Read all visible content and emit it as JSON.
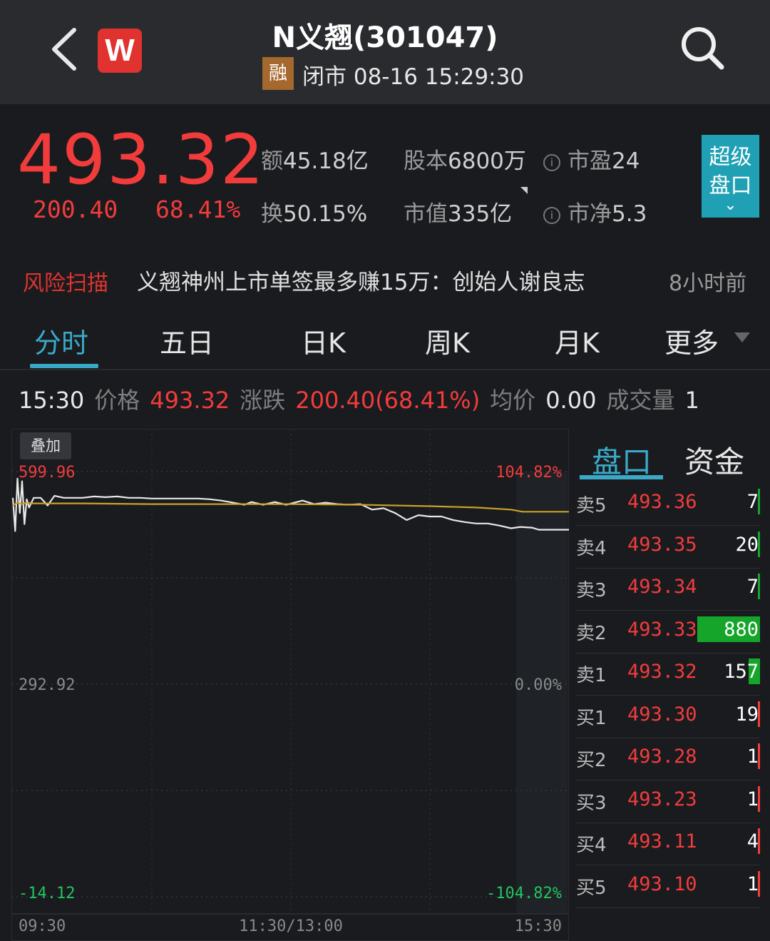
{
  "header": {
    "title": "N义翘(301047)",
    "logo_letter": "W",
    "badge": "融",
    "status": "闭市 08-16 15:29:30"
  },
  "quote": {
    "price": "493.32",
    "change": "200.40",
    "change_pct": "68.41%",
    "turnover_amount": {
      "label": "额",
      "value": "45.18亿"
    },
    "share_capital": {
      "label": "股本",
      "value": "6800万"
    },
    "pe": {
      "label": "市盈",
      "value": "24"
    },
    "turnover_rate": {
      "label": "换",
      "value": "50.15%"
    },
    "market_cap": {
      "label": "市值",
      "value": "335亿"
    },
    "pb": {
      "label": "市净",
      "value": "5.3"
    },
    "super_button": [
      "超级",
      "盘口"
    ]
  },
  "news": {
    "label": "风险扫描",
    "text": "义翘神州上市单签最多赚15万：创始人谢良志",
    "time": "8小时前"
  },
  "tabs": [
    "分时",
    "五日",
    "日K",
    "周K",
    "月K",
    "更多"
  ],
  "info_line": {
    "time": "15:30",
    "price_label": "价格",
    "price": "493.32",
    "change_label": "涨跌",
    "change": "200.40(68.41%)",
    "avg_label": "均价",
    "avg": "0.00",
    "vol_label": "成交量",
    "vol": "1"
  },
  "chart_data": {
    "type": "line",
    "overlay_button": "叠加",
    "y_left_labels": [
      "599.96",
      "292.92",
      "-14.12"
    ],
    "y_right_labels": [
      "104.82%",
      "0.00%",
      "-104.82%"
    ],
    "x_labels": [
      "09:30",
      "11:30/13:00",
      "15:30"
    ],
    "ylim": [
      -14.12,
      599.96
    ],
    "base": 292.92,
    "total_minutes": 240,
    "series": [
      {
        "points": [
          [
            0,
            562
          ],
          [
            1,
            514
          ],
          [
            2,
            590
          ],
          [
            3,
            540
          ],
          [
            4,
            586
          ],
          [
            5,
            524
          ],
          [
            6,
            560
          ],
          [
            7,
            548
          ],
          [
            9,
            562
          ],
          [
            12,
            562
          ],
          [
            15,
            551
          ],
          [
            18,
            565
          ],
          [
            22,
            562
          ],
          [
            26,
            562
          ],
          [
            30,
            562
          ],
          [
            35,
            564
          ],
          [
            40,
            563
          ],
          [
            45,
            564
          ],
          [
            50,
            562
          ],
          [
            55,
            562
          ],
          [
            60,
            561
          ],
          [
            65,
            561
          ],
          [
            70,
            561
          ],
          [
            75,
            561
          ],
          [
            80,
            561
          ],
          [
            85,
            560
          ],
          [
            90,
            558
          ],
          [
            95,
            555
          ],
          [
            100,
            552
          ],
          [
            103,
            556
          ],
          [
            108,
            552
          ],
          [
            113,
            556
          ],
          [
            118,
            552
          ],
          [
            125,
            558
          ],
          [
            130,
            553
          ],
          [
            135,
            555
          ],
          [
            140,
            553
          ],
          [
            145,
            552
          ],
          [
            150,
            553
          ],
          [
            155,
            545
          ],
          [
            160,
            547
          ],
          [
            165,
            540
          ],
          [
            170,
            530
          ],
          [
            175,
            537
          ],
          [
            180,
            535
          ],
          [
            185,
            535
          ],
          [
            190,
            530
          ],
          [
            195,
            527
          ],
          [
            200,
            525
          ],
          [
            205,
            525
          ],
          [
            210,
            522
          ],
          [
            215,
            518
          ],
          [
            219,
            520
          ],
          [
            224,
            519
          ],
          [
            227,
            516
          ],
          [
            232,
            516
          ],
          [
            236,
            516
          ],
          [
            240,
            516
          ]
        ]
      },
      {
        "points": [
          [
            0,
            551
          ],
          [
            2,
            555
          ],
          [
            4,
            553
          ],
          [
            6,
            555
          ],
          [
            8,
            554
          ],
          [
            10,
            554
          ],
          [
            30,
            554
          ],
          [
            60,
            553
          ],
          [
            90,
            553
          ],
          [
            120,
            553
          ],
          [
            150,
            552
          ],
          [
            180,
            550
          ],
          [
            200,
            548
          ],
          [
            215,
            545
          ],
          [
            220,
            542
          ],
          [
            230,
            542
          ],
          [
            240,
            542
          ]
        ]
      }
    ]
  },
  "orderbook": {
    "tabs": [
      "盘口",
      "资金"
    ],
    "rows": [
      {
        "side": "卖5",
        "price": "493.36",
        "vol": "7",
        "type": "sell",
        "bar": 0.01
      },
      {
        "side": "卖4",
        "price": "493.35",
        "vol": "20",
        "type": "sell",
        "bar": 0.02
      },
      {
        "side": "卖3",
        "price": "493.34",
        "vol": "7",
        "type": "sell",
        "bar": 0.01
      },
      {
        "side": "卖2",
        "price": "493.33",
        "vol": "880",
        "type": "sell",
        "bar": 1.0
      },
      {
        "side": "卖1",
        "price": "493.32",
        "vol": "157",
        "type": "sell",
        "bar": 0.18
      },
      {
        "side": "买1",
        "price": "493.30",
        "vol": "19",
        "type": "buy",
        "bar": 0.02
      },
      {
        "side": "买2",
        "price": "493.28",
        "vol": "1",
        "type": "buy",
        "bar": 0.01
      },
      {
        "side": "买3",
        "price": "493.23",
        "vol": "1",
        "type": "buy",
        "bar": 0.01
      },
      {
        "side": "买4",
        "price": "493.11",
        "vol": "4",
        "type": "buy",
        "bar": 0.01
      },
      {
        "side": "买5",
        "price": "493.10",
        "vol": "1",
        "type": "buy",
        "bar": 0.01
      }
    ]
  },
  "colors": {
    "up": "#f23c3c",
    "down": "#22c55e",
    "accent": "#3aa9c8",
    "price_line": "#e8e8e8",
    "avg_line": "#c9a227"
  }
}
